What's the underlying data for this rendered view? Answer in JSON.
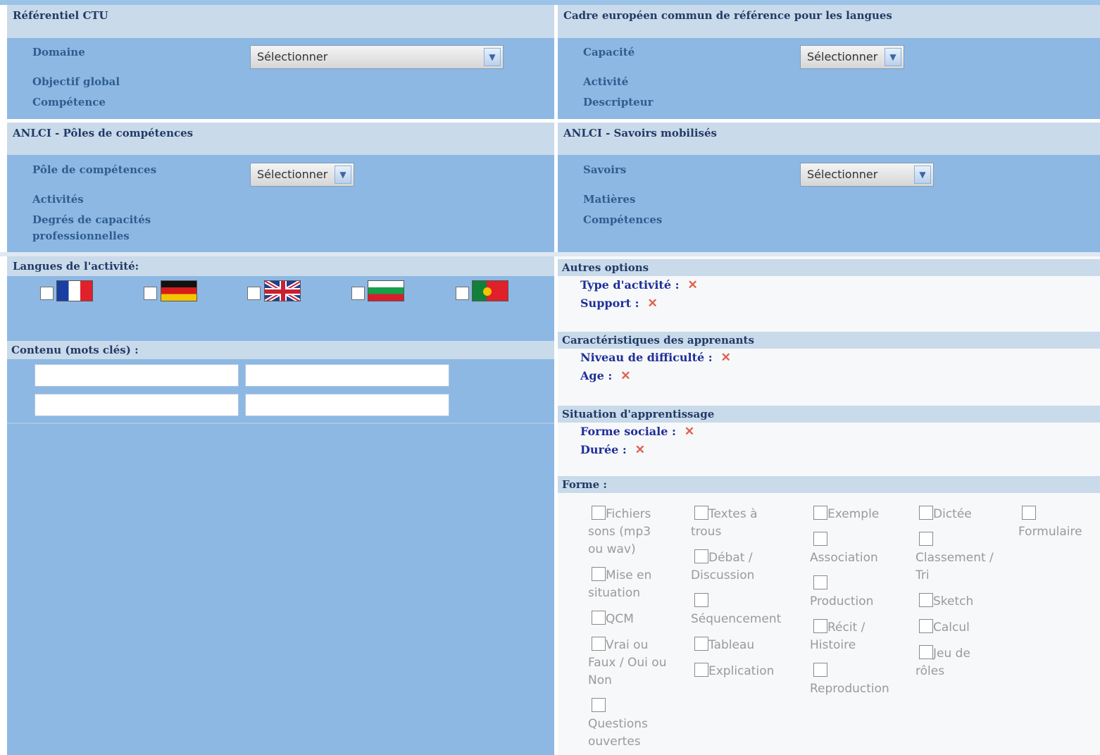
{
  "ctu": {
    "title": "Référentiel CTU",
    "labels": [
      "Domaine",
      "Objectif global",
      "Compétence"
    ],
    "select_value": "Sélectionner"
  },
  "cecr": {
    "title": "Cadre européen commun de référence pour les langues",
    "labels": [
      "Capacité",
      "Activité",
      "Descripteur"
    ],
    "select_value": "Sélectionner"
  },
  "anlci_poles": {
    "title": "ANLCI - Pôles de compétences",
    "labels": [
      "Pôle de compétences",
      "Activités",
      "Degrés de capacités",
      "professionnelles"
    ],
    "select_value": "Sélectionner"
  },
  "anlci_savoirs": {
    "title": "ANLCI - Savoirs mobilisés",
    "labels": [
      "Savoirs",
      "Matières",
      "Compétences"
    ],
    "select_value": "Sélectionner"
  },
  "languages": {
    "title": "Langues de l'activité:",
    "flags": [
      "flag-france",
      "flag-germany",
      "flag-uk",
      "flag-bulgaria",
      "flag-portugal"
    ]
  },
  "keywords": {
    "title": "Contenu (mots clés) :",
    "fields": [
      "",
      "",
      "",
      ""
    ]
  },
  "autres": {
    "title": "Autres options",
    "items": [
      "Type d'activité :",
      "Support :"
    ]
  },
  "apprenants": {
    "title": "Caractéristiques des apprenants",
    "items": [
      "Niveau de difficulté :",
      "Age :"
    ]
  },
  "situation": {
    "title": "Situation d'apprentissage",
    "items": [
      "Forme sociale :",
      "Durée :"
    ]
  },
  "forme": {
    "title": "Forme :",
    "col1": [
      "Fichiers",
      "sons (mp3",
      "ou wav)",
      "Mise en",
      "situation",
      "QCM",
      "Vrai ou",
      "Faux / Oui ou",
      "Non",
      "Questions",
      "ouvertes"
    ],
    "col2": [
      "Textes à",
      "trous",
      "Débat /",
      "Discussion",
      "Séquencement",
      "Tableau",
      "Explication"
    ],
    "col3": [
      "Exemple",
      "Association",
      "Production",
      "Récit /",
      "Histoire",
      "Reproduction"
    ],
    "col4": [
      "Dictée",
      "Classement /",
      "Tri",
      "Sketch",
      "Calcul",
      "Jeu de",
      "rôles"
    ],
    "col5": [
      "Formulaire"
    ]
  },
  "remove_mark": "✕",
  "colors": {
    "panel": "#8db8e3",
    "header": "#c9daea",
    "option_text": "#1f2f99",
    "remove": "#e0604e"
  }
}
